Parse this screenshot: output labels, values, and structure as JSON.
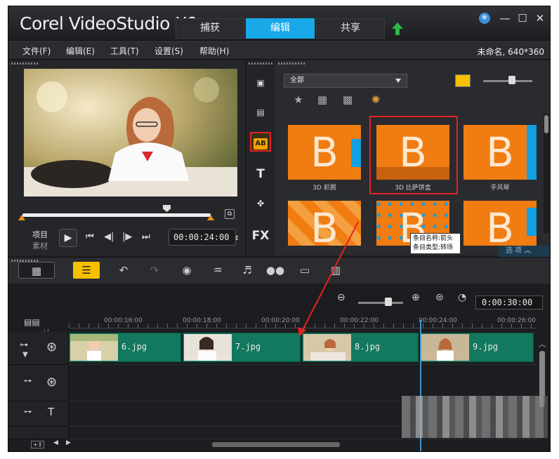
{
  "app": {
    "title": "Corel VideoStudio X9",
    "tabs": [
      "捕获",
      "编辑",
      "共享"
    ],
    "active_tab": "编辑",
    "project_info": "未命名, 640*360",
    "accent_color": "#19a8e8"
  },
  "menu": [
    "文件(F)",
    "编辑(E)",
    "工具(T)",
    "设置(S)",
    "帮助(H)"
  ],
  "player": {
    "mode_project": "项目",
    "mode_clip": "素材",
    "timecode": "00:00:24:00 ⇕",
    "play_icon": "play-icon",
    "scrub_progress": 0.8
  },
  "library": {
    "category_dropdown": "全部",
    "selected_side_icon": "transition-ab-icon",
    "thumbnails": [
      {
        "letter": "B",
        "label": "3D 彩屑"
      },
      {
        "letter": "_B_",
        "label": "3D 比萨饼盒"
      },
      {
        "letter": "B",
        "label": "手风琴"
      },
      {
        "letter": "B",
        "label": ""
      },
      {
        "letter": "B",
        "label": ""
      },
      {
        "letter": "B",
        "label": ""
      }
    ],
    "tooltip_line1": "条目名称:箭头",
    "tooltip_line2": "条目类型:转场",
    "options_label": "选 项",
    "side_fx_label": "FX",
    "side_title_label": "T"
  },
  "timeline": {
    "total_time": "0:00:30:00",
    "ruler_ticks": [
      "00:00:16:00",
      "00:00:18:00",
      "00:00:20:00",
      "00:00:22:00",
      "00:00:24:00",
      "00:00:26:00"
    ],
    "clips": [
      "6.jpg",
      "7.jpg",
      "8.jpg",
      "9.jpg"
    ],
    "title_track_label": "T",
    "add_track_label": "+/−"
  }
}
